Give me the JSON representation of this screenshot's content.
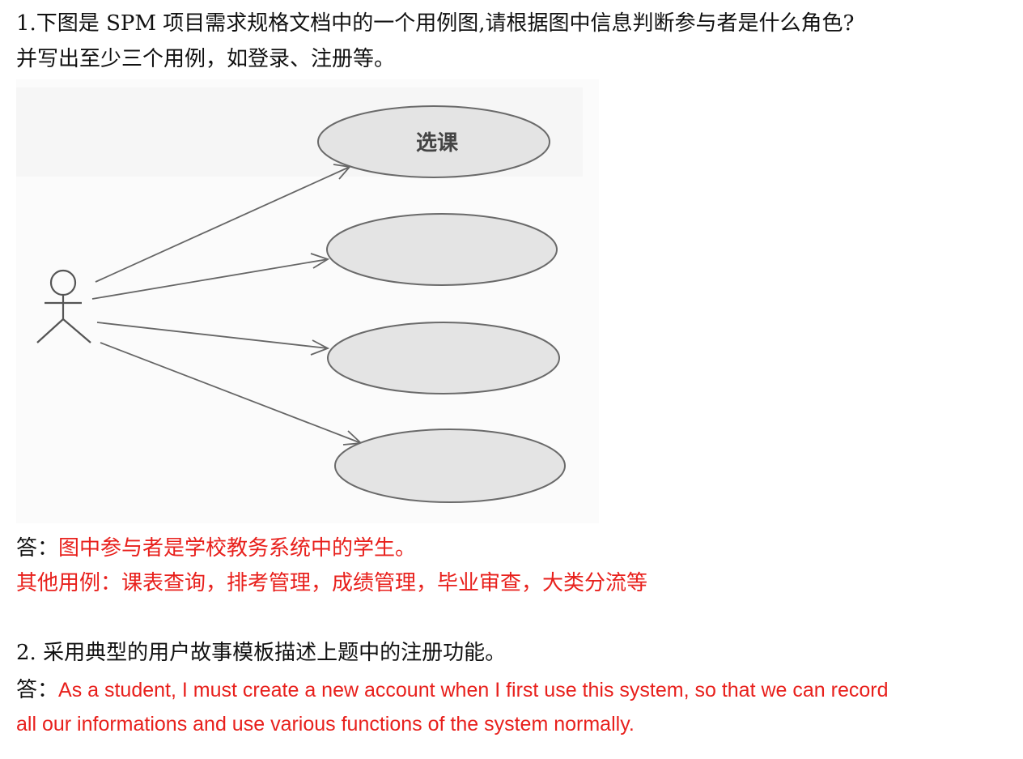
{
  "question1": {
    "line1": "1.下图是 SPM 项目需求规格文档中的一个用例图,请根据图中信息判断参与者是什么角色?",
    "line2": "并写出至少三个用例，如登录、注册等。"
  },
  "diagram": {
    "actor_icon": "stick-figure-actor",
    "use_cases": [
      {
        "label": "选课"
      },
      {
        "label": ""
      },
      {
        "label": ""
      },
      {
        "label": ""
      }
    ]
  },
  "answer1": {
    "prefix": "答：",
    "line1": "图中参与者是学校教务系统中的学生。",
    "line2": "其他用例：课表查询，排考管理，成绩管理，毕业审查，大类分流等"
  },
  "question2": {
    "text": "2.  采用典型的用户故事模板描述上题中的注册功能。"
  },
  "answer2": {
    "prefix": "答：",
    "line1": "As a student, I must create a new account when I first use this system, so that we can record",
    "line2": "all our informations and use various functions of the system normally."
  },
  "colors": {
    "answer": "#e8201c",
    "ellipse_fill": "#e4e4e4",
    "ellipse_stroke": "#6a6a6a"
  }
}
